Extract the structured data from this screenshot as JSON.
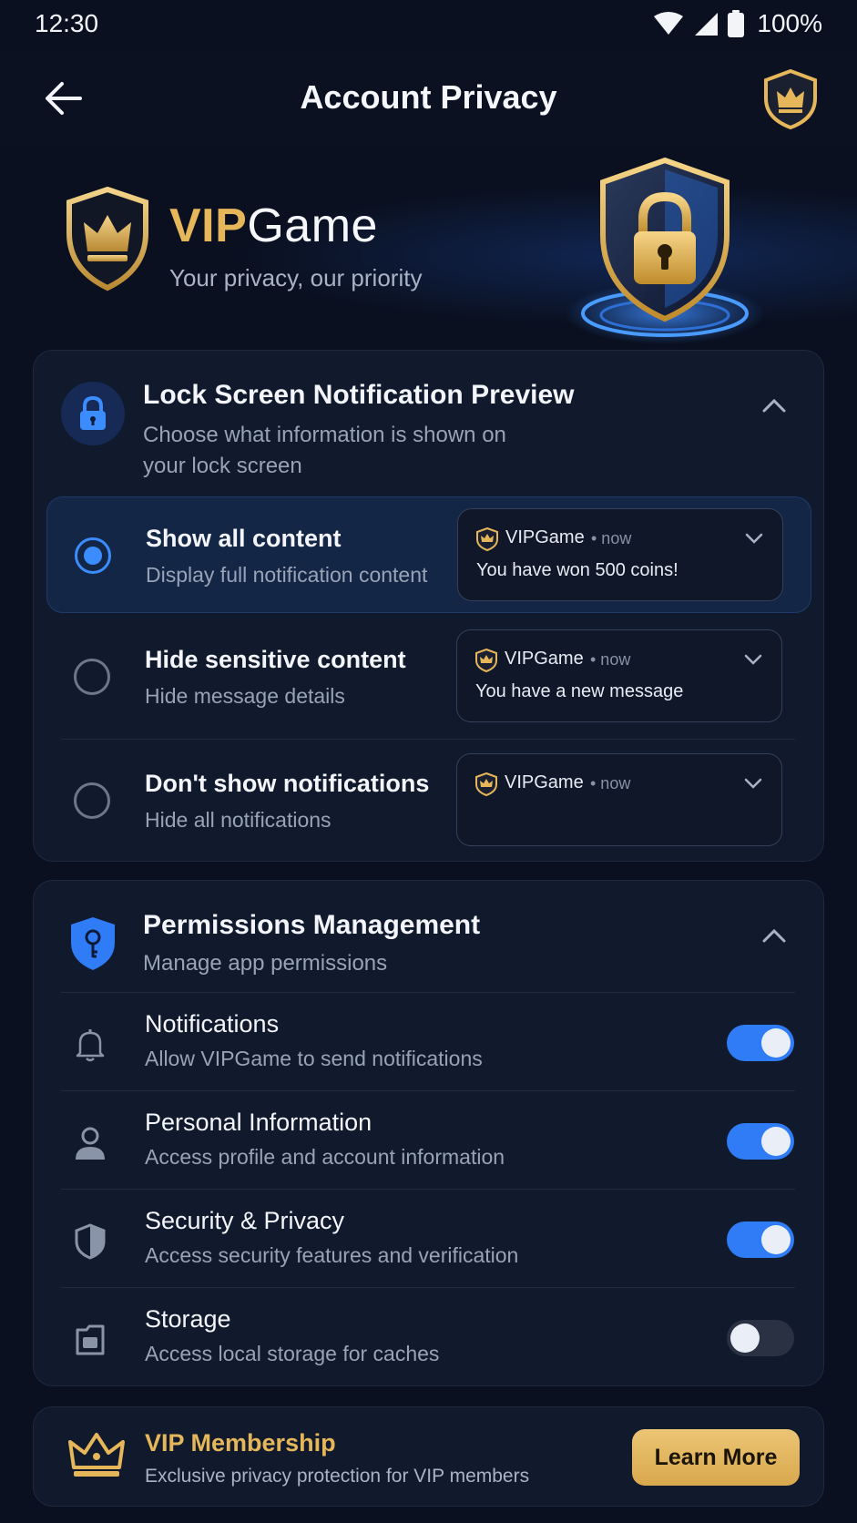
{
  "status_bar": {
    "time": "12:30",
    "battery": "100%"
  },
  "app_bar": {
    "title": "Account Privacy"
  },
  "hero": {
    "brand_vip": "VIP",
    "brand_game": "Game",
    "tagline": "Your privacy, our priority"
  },
  "lock_screen": {
    "title": "Lock Screen Notification Preview",
    "subtitle": "Choose what information is shown on your lock screen",
    "options": [
      {
        "title": "Show all content",
        "desc": "Display full notification content",
        "selected": true,
        "preview": {
          "app": "VIPGame",
          "time": "• now",
          "message": "You have won 500 coins!"
        }
      },
      {
        "title": "Hide sensitive content",
        "desc": "Hide message details",
        "selected": false,
        "preview": {
          "app": "VIPGame",
          "time": "• now",
          "message": "You have a new message"
        }
      },
      {
        "title": "Don't show notifications",
        "desc": "Hide all notifications",
        "selected": false,
        "preview": {
          "app": "VIPGame",
          "time": "• now",
          "message": ""
        }
      }
    ]
  },
  "permissions": {
    "title": "Permissions Management",
    "subtitle": "Manage app permissions",
    "items": [
      {
        "icon": "bell-icon",
        "title": "Notifications",
        "desc": "Allow VIPGame to send notifications",
        "enabled": true
      },
      {
        "icon": "person-icon",
        "title": "Personal Information",
        "desc": "Access profile and account information",
        "enabled": true
      },
      {
        "icon": "shield-icon",
        "title": "Security & Privacy",
        "desc": "Access security features and verification",
        "enabled": true
      },
      {
        "icon": "storage-icon",
        "title": "Storage",
        "desc": "Access local storage for caches",
        "enabled": false
      }
    ]
  },
  "vip_banner": {
    "title": "VIP Membership",
    "desc": "Exclusive privacy protection for VIP members",
    "button": "Learn More"
  },
  "colors": {
    "accent": "#3b8cff",
    "gold": "#e6b65a",
    "background": "#0a1020",
    "card": "#111a2c"
  }
}
